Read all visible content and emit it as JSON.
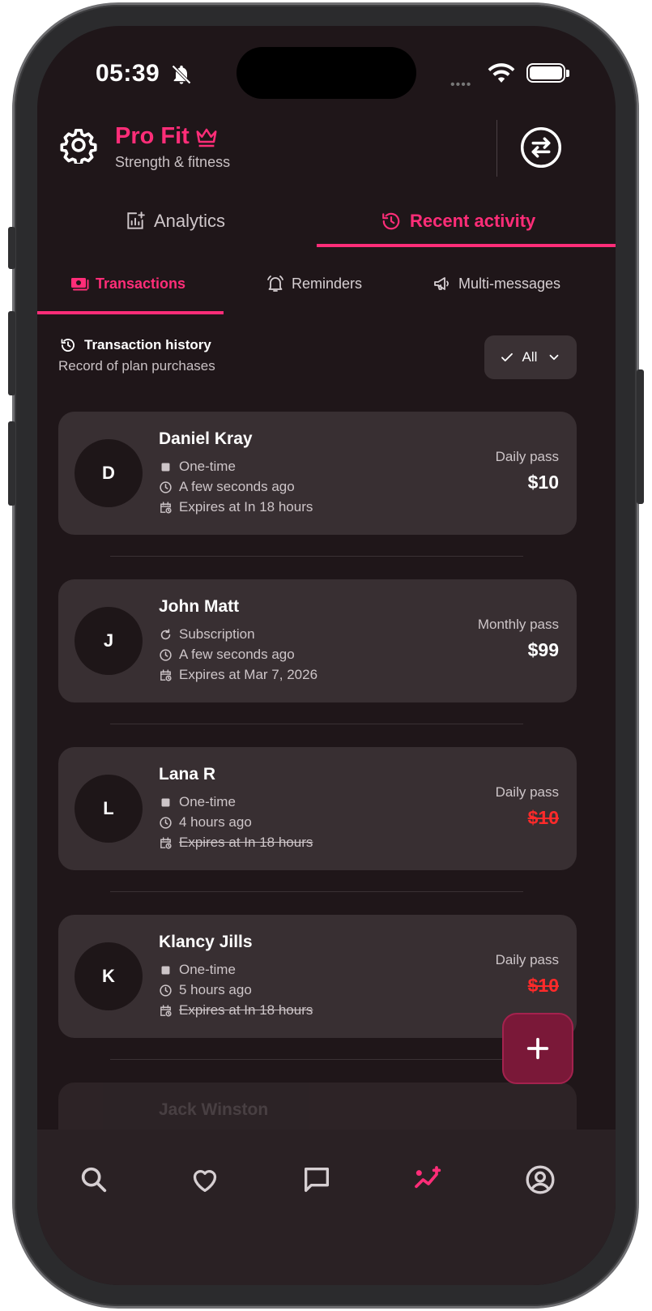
{
  "status_bar": {
    "time": "05:39",
    "dots": "••••"
  },
  "header": {
    "brand_name": "Pro Fit",
    "brand_subtitle": "Strength & fitness"
  },
  "main_tabs": [
    {
      "label": "Analytics",
      "active": false
    },
    {
      "label": "Recent activity",
      "active": true
    }
  ],
  "sub_tabs": [
    {
      "label": "Transactions",
      "active": true
    },
    {
      "label": "Reminders",
      "active": false
    },
    {
      "label": "Multi-messages",
      "active": false
    }
  ],
  "section": {
    "title": "Transaction history",
    "subtitle": "Record of plan purchases",
    "filter_label": "All"
  },
  "transactions": [
    {
      "initial": "D",
      "name": "Daniel Kray",
      "type": "One-time",
      "time": "A few seconds ago",
      "expires": "Expires at In 18 hours",
      "plan": "Daily pass",
      "price": "$10",
      "expired": false
    },
    {
      "initial": "J",
      "name": "John Matt",
      "type": "Subscription",
      "time": "A few seconds ago",
      "expires": "Expires at Mar 7, 2026",
      "plan": "Monthly pass",
      "price": "$99",
      "expired": false
    },
    {
      "initial": "L",
      "name": "Lana R",
      "type": "One-time",
      "time": "4 hours ago",
      "expires": "Expires at In 18 hours",
      "plan": "Daily pass",
      "price": "$10",
      "expired": true
    },
    {
      "initial": "K",
      "name": "Klancy Jills",
      "type": "One-time",
      "time": "5 hours ago",
      "expires": "Expires at In 18 hours",
      "plan": "Daily pass",
      "price": "$10",
      "expired": true
    },
    {
      "name": "Jack Winston"
    }
  ],
  "colors": {
    "accent": "#ff2d78",
    "expired": "#ff2a2a",
    "background": "#1f1619",
    "card": "#382f32"
  },
  "bottom_nav": [
    "search-icon",
    "heart-icon",
    "chat-icon",
    "activity-icon",
    "profile-icon"
  ]
}
